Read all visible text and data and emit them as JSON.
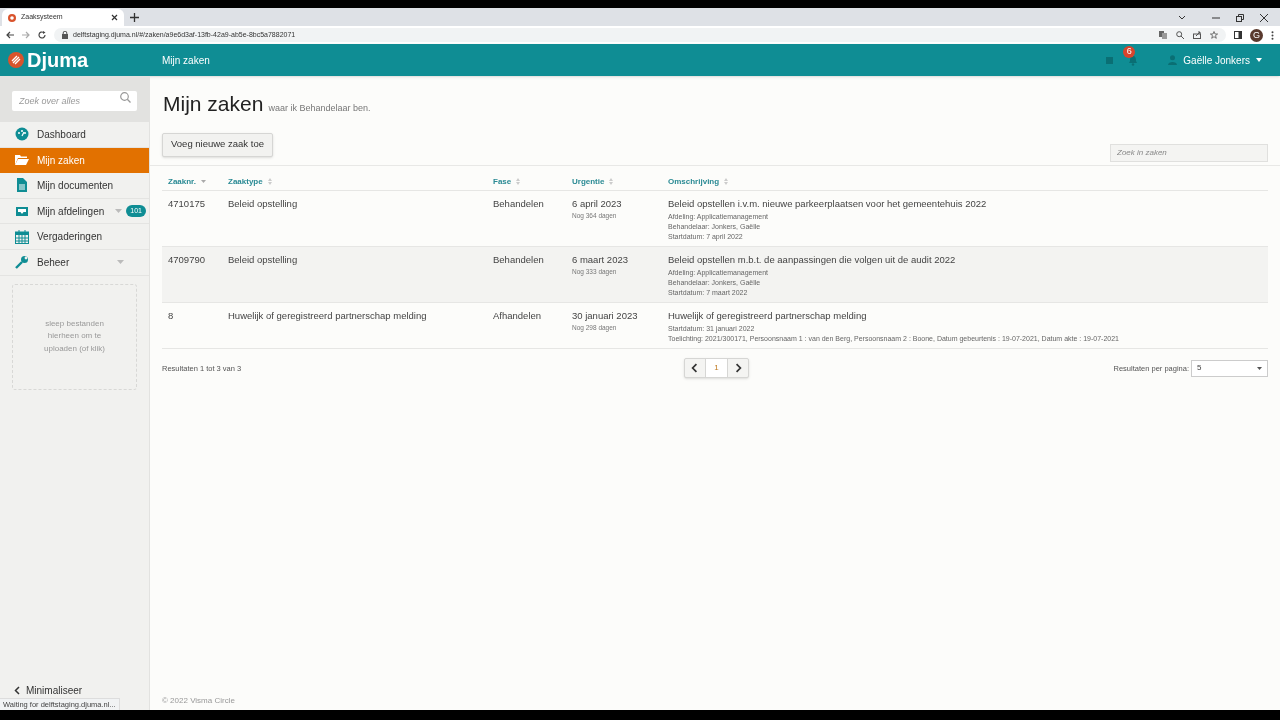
{
  "browser": {
    "tab_title": "Zaaksysteem",
    "url": "delftstaging.djuma.nl/#/zaken/a9e6d3af-13fb-42a9-ab5e-8bc5a7882071",
    "profile_initial": "G",
    "status": "Waiting for delftstaging.djuma.nl..."
  },
  "header": {
    "logo": "Djuma",
    "title": "Mijn zaken",
    "notification_count": "6",
    "user": "Gaëlle Jonkers"
  },
  "sidebar": {
    "search": {
      "placeholder": "Zoek over alles"
    },
    "items": [
      {
        "kind": "dashboard",
        "label": "Dashboard",
        "selected": false
      },
      {
        "kind": "folder",
        "label": "Mijn zaken",
        "selected": true
      },
      {
        "kind": "document",
        "label": "Mijn documenten",
        "selected": false
      },
      {
        "kind": "inbox",
        "label": "Mijn afdelingen",
        "selected": false,
        "badge": "101",
        "expandable": true
      },
      {
        "kind": "calendar",
        "label": "Vergaderingen",
        "selected": false
      },
      {
        "kind": "wrench",
        "label": "Beheer",
        "selected": false,
        "expandable": true
      }
    ],
    "dropzone": "sleep bestanden hierheen om te uploaden (of klik)",
    "minimize": "Minimaliseer"
  },
  "page": {
    "title": "Mijn zaken",
    "subtitle": "waar ik Behandelaar ben.",
    "add_button": "Voeg nieuwe zaak toe",
    "search": {
      "placeholder": "Zoek in zaken"
    }
  },
  "table": {
    "columns": [
      {
        "label": "Zaaknr.",
        "sorted": true
      },
      {
        "label": "Zaaktype",
        "sorted": false
      },
      {
        "label": "Fase",
        "sorted": false
      },
      {
        "label": "Urgentie",
        "sorted": false
      },
      {
        "label": "Omschrijving",
        "sorted": false
      }
    ],
    "rows": [
      {
        "number": "4710175",
        "type": "Beleid opstelling",
        "phase": "Behandelen",
        "date": "6 april 2023",
        "remaining": "Nog 364 dagen",
        "description": "Beleid opstellen i.v.m. nieuwe parkeerplaatsen voor het gemeentehuis 2022",
        "details": [
          "Afdeling: Applicatiemanagement",
          "Behandelaar: Jonkers, Gaëlle",
          "Startdatum: 7 april 2022"
        ]
      },
      {
        "number": "4709790",
        "type": "Beleid opstelling",
        "phase": "Behandelen",
        "date": "6 maart 2023",
        "remaining": "Nog 333 dagen",
        "description": "Beleid opstellen m.b.t. de aanpassingen die volgen uit de audit 2022",
        "details": [
          "Afdeling: Applicatiemanagement",
          "Behandelaar: Jonkers, Gaëlle",
          "Startdatum: 7 maart 2022"
        ]
      },
      {
        "number": "8",
        "type": "Huwelijk of geregistreerd partnerschap melding",
        "phase": "Afhandelen",
        "date": "30 januari 2023",
        "remaining": "Nog 298 dagen",
        "description": "Huwelijk of geregistreerd partnerschap melding",
        "details": [
          "Startdatum: 31 januari 2022",
          "Toelichting: 2021/300171, Persoonsnaam 1 : van den Berg, Persoonsnaam 2 : Boone, Datum gebeurtenis : 19-07-2021, Datum akte : 19-07-2021"
        ]
      }
    ]
  },
  "footer": {
    "results": "Resultaten 1 tot 3 van 3",
    "page": "1",
    "per_page_label": "Resultaten per pagina:",
    "per_page": "5",
    "copyright": "© 2022 Visma Circle"
  }
}
